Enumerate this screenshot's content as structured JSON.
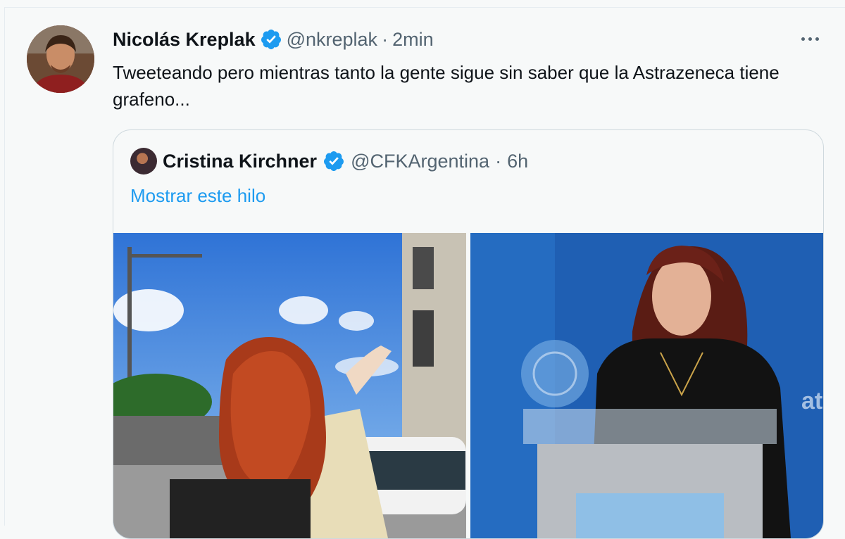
{
  "tweet": {
    "author_name": "Nicolás Kreplak",
    "handle": "@nkreplak",
    "separator": "·",
    "time": "2min",
    "text": "Tweeteando pero mientras tanto la gente sigue sin saber que la Astrazeneca tiene grafeno...",
    "icons": {
      "verified": "verified-badge-icon",
      "more": "more-options-icon"
    }
  },
  "quoted": {
    "author_name": "Cristina Kirchner",
    "handle": "@CFKArgentina",
    "separator": "·",
    "time": "6h",
    "show_thread": "Mostrar este hilo",
    "photos": [
      "photo-waving-to-crowd",
      "photo-at-podium"
    ]
  },
  "colors": {
    "link_blue": "#1d9bf0",
    "verified_blue": "#1d9bf0",
    "text_primary": "#0f1419",
    "text_secondary": "#536471",
    "background": "#f7f9f9"
  }
}
